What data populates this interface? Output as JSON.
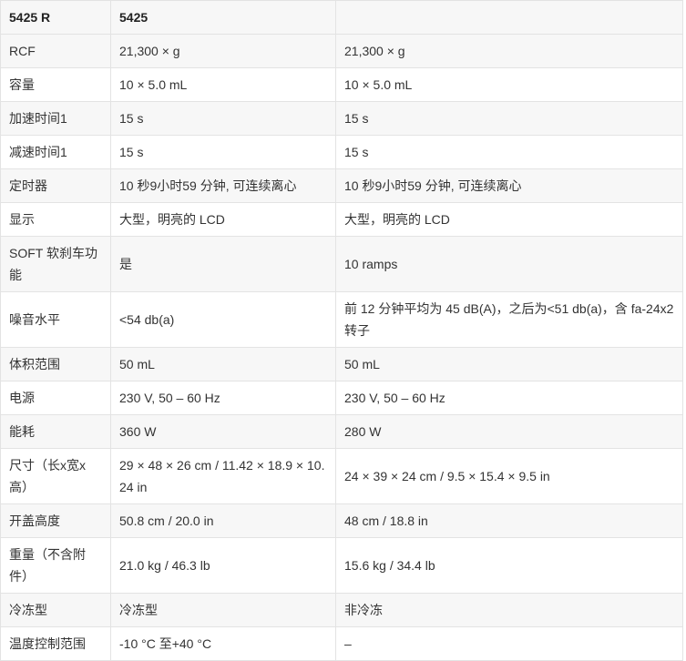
{
  "table": {
    "headers": [
      "5425 R",
      "5425",
      ""
    ],
    "rows": [
      [
        "RCF",
        "21,300 × g",
        "21,300 × g"
      ],
      [
        "容量",
        "10 × 5.0 mL",
        "10 × 5.0 mL"
      ],
      [
        "加速时间1",
        "15 s",
        "15 s"
      ],
      [
        "减速时间1",
        "15 s",
        "15 s"
      ],
      [
        "定时器",
        "10 秒9小时59 分钟, 可连续离心",
        "10 秒9小时59 分钟, 可连续离心"
      ],
      [
        "显示",
        "大型，明亮的 LCD",
        "大型，明亮的 LCD"
      ],
      [
        "SOFT 软刹车功能",
        "是",
        "10 ramps"
      ],
      [
        "噪音水平",
        "<54 db(a)",
        "前 12 分钟平均为 45 dB(A)，之后为<51 db(a)，含 fa-24x2 转子"
      ],
      [
        "体积范围",
        "50 mL",
        "50 mL"
      ],
      [
        "电源",
        "230 V, 50 – 60 Hz",
        "230 V, 50 – 60 Hz"
      ],
      [
        "能耗",
        "360 W",
        "280 W"
      ],
      [
        "尺寸（长x宽x高）",
        "29 × 48 × 26 cm / 11.42 × 18.9 × 10.24 in",
        "24 × 39 × 24 cm / 9.5 × 15.4 × 9.5 in"
      ],
      [
        "开盖高度",
        "50.8 cm / 20.0 in",
        "48 cm / 18.8 in"
      ],
      [
        "重量（不含附件）",
        "21.0 kg / 46.3 lb",
        "15.6 kg / 34.4 lb"
      ],
      [
        "冷冻型",
        "冷冻型",
        "非冷冻"
      ],
      [
        "温度控制范围",
        "-10 °C 至+40 °C",
        "–"
      ]
    ]
  }
}
